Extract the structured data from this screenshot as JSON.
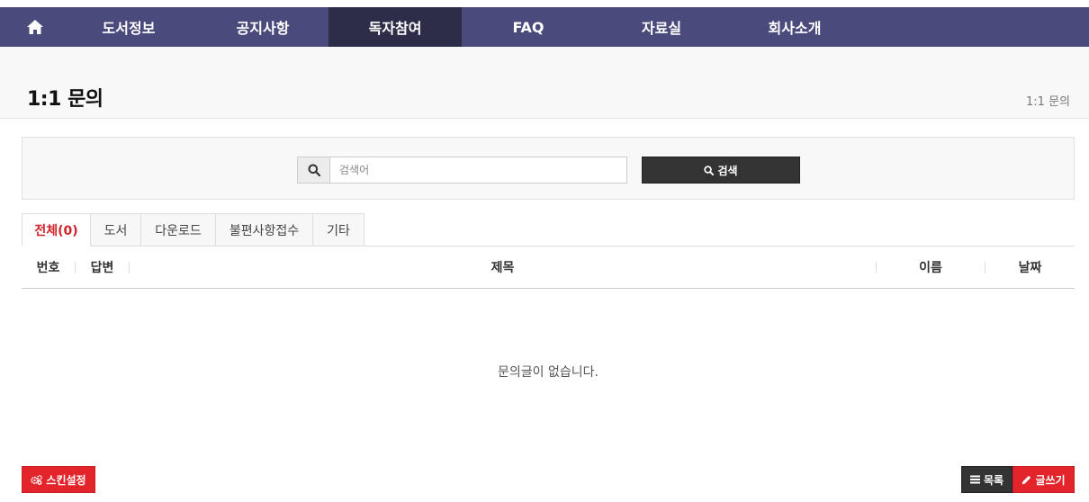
{
  "nav": {
    "items": [
      {
        "label": "도서정보"
      },
      {
        "label": "공지사항"
      },
      {
        "label": "독자참여",
        "active": true
      },
      {
        "label": "FAQ"
      },
      {
        "label": "자료실"
      },
      {
        "label": "회사소개"
      }
    ]
  },
  "header": {
    "title": "1:1 문의",
    "breadcrumb": "1:1 문의"
  },
  "search": {
    "placeholder": "검색어",
    "value": "",
    "button_label": "검색"
  },
  "tabs": [
    {
      "label": "전체(0)",
      "active": true
    },
    {
      "label": "도서"
    },
    {
      "label": "다운로드"
    },
    {
      "label": "불편사항접수"
    },
    {
      "label": "기타"
    }
  ],
  "table": {
    "columns": [
      "번호",
      "답변",
      "제목",
      "이름",
      "날짜"
    ],
    "rows": [],
    "empty_message": "문의글이 없습니다."
  },
  "buttons": {
    "skin_label": "스킨설정",
    "list_label": "목록",
    "write_label": "글쓰기"
  },
  "colors": {
    "nav_bg": "#4a4a7c",
    "nav_active": "#2d2d4a",
    "accent_red": "#e3242b",
    "dark_button": "#333333"
  }
}
